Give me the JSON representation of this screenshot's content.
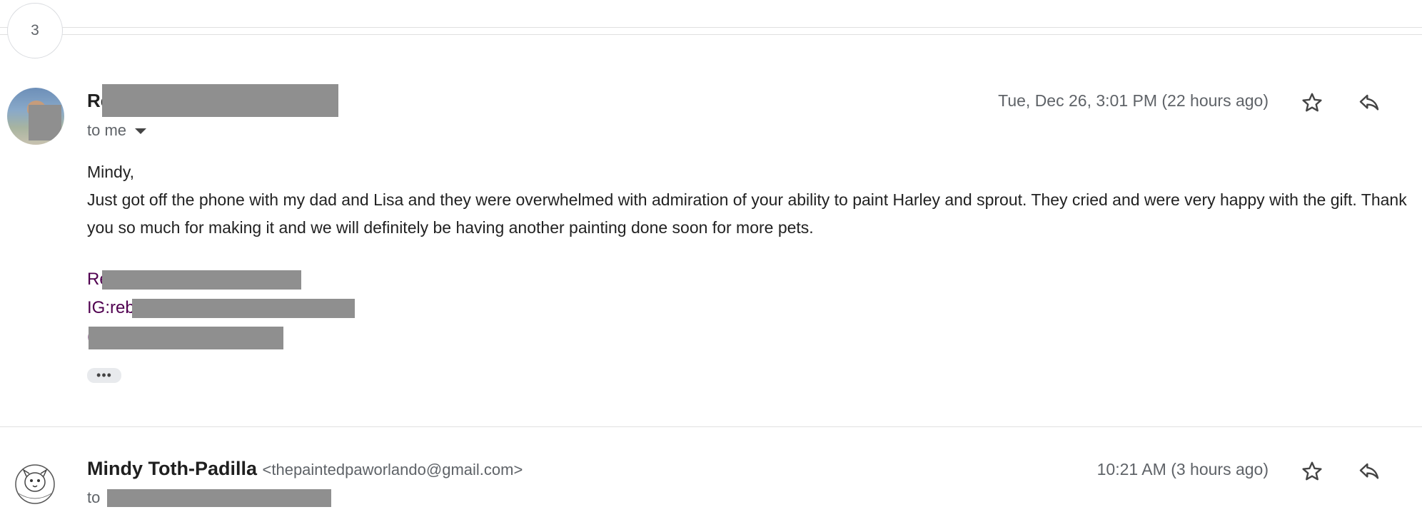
{
  "collapsed": {
    "count": "3"
  },
  "message1": {
    "sender_initials": "Re",
    "to_label": "to me",
    "date": "Tue, Dec 26, 3:01 PM (22 hours ago)",
    "greeting": "Mindy,",
    "body": "Just got off the phone with my dad and Lisa and they were overwhelmed with admiration of your ability to paint Harley and sprout. They cried and were very happy with the gift. Thank you so much for making it and we will definitely be having another painting done soon for more pets.",
    "signature": [
      "Re",
      "IG:reb",
      "("
    ],
    "more_label": "•••",
    "sig_color": "#500050"
  },
  "message2": {
    "sender_name": "Mindy Toth-Padilla",
    "sender_email": "<thepaintedpaworlando@gmail.com>",
    "to_label": "to ",
    "date": "10:21 AM (3 hours ago)"
  },
  "icons": [
    "star-icon",
    "reply-icon",
    "dropdown-caret-icon"
  ],
  "colors": {
    "redaction": "#8f8f8f",
    "muted_text": "#5f6368"
  }
}
